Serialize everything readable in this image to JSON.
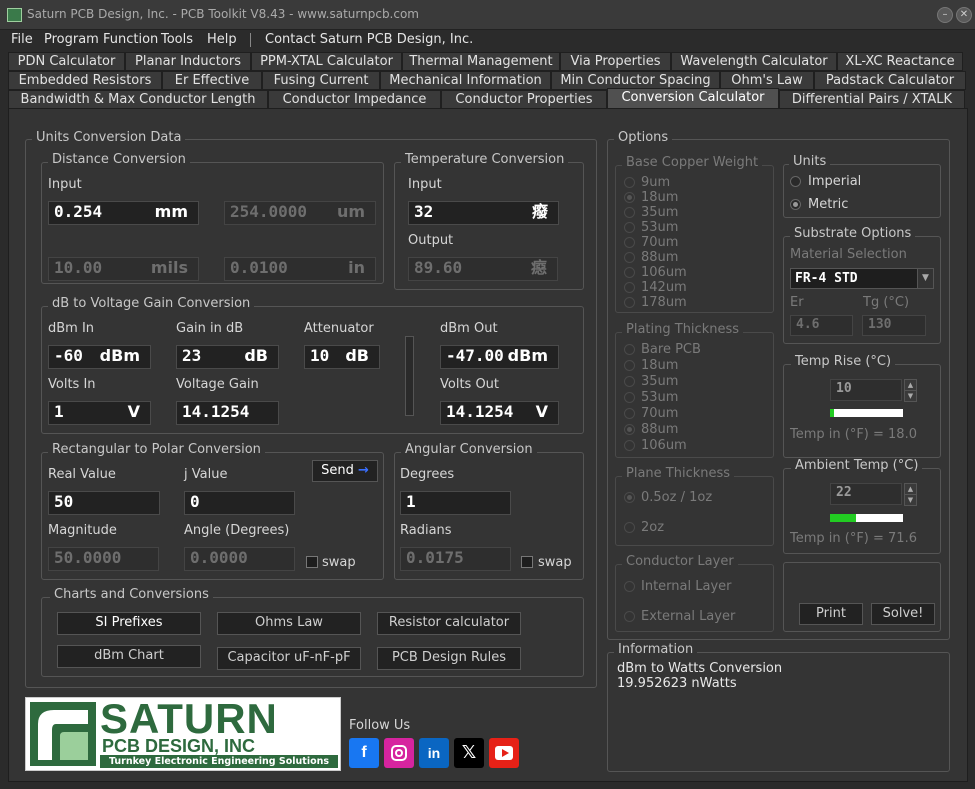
{
  "window": {
    "title": "Saturn PCB Design, Inc. - PCB Toolkit V8.43 - www.saturnpcb.com"
  },
  "menu": {
    "items": [
      "File",
      "Program Function",
      "Tools",
      "Help",
      "Contact Saturn PCB Design, Inc."
    ]
  },
  "tabs": {
    "row1": [
      "PDN Calculator",
      "Planar Inductors",
      "PPM-XTAL Calculator",
      "Thermal Management",
      "Via Properties",
      "Wavelength Calculator",
      "XL-XC Reactance"
    ],
    "row2": [
      "Embedded Resistors",
      "Er Effective",
      "Fusing Current",
      "Mechanical Information",
      "Min Conductor Spacing",
      "Ohm's Law",
      "Padstack Calculator"
    ],
    "row3": [
      "Bandwidth & Max Conductor Length",
      "Conductor Impedance",
      "Conductor Properties",
      "Conversion Calculator",
      "Differential Pairs / XTALK"
    ],
    "active": "Conversion Calculator"
  },
  "units_conversion": {
    "title": "Units Conversion Data"
  },
  "distance": {
    "title": "Distance Conversion",
    "input_label": "Input",
    "input_value": "0.254",
    "input_unit": "mm",
    "out1_value": "254.0000",
    "out1_unit": "um",
    "out2_value": "10.00",
    "out2_unit": "mils",
    "out3_value": "0.0100",
    "out3_unit": "in"
  },
  "temperature": {
    "title": "Temperature Conversion",
    "input_label": "Input",
    "input_value": "32",
    "input_unit": "癈",
    "output_label": "Output",
    "output_value": "89.60",
    "output_unit": "癋"
  },
  "db_gain": {
    "title": "dB to Voltage Gain Conversion",
    "dbm_in_label": "dBm In",
    "dbm_in_value": "-60",
    "dbm_in_unit": "dBm",
    "gain_db_label": "Gain in dB",
    "gain_db_value": "23",
    "gain_db_unit": "dB",
    "atten_label": "Attenuator",
    "atten_value": "10",
    "atten_unit": "dB",
    "dbm_out_label": "dBm Out",
    "dbm_out_value": "-47.00",
    "dbm_out_unit": "dBm",
    "volts_in_label": "Volts In",
    "volts_in_value": "1",
    "volts_in_unit": "V",
    "vgain_label": "Voltage Gain",
    "vgain_value": "14.1254",
    "volts_out_label": "Volts Out",
    "volts_out_value": "14.1254",
    "volts_out_unit": "V"
  },
  "rect_polar": {
    "title": "Rectangular to Polar Conversion",
    "real_label": "Real Value",
    "real_value": "50",
    "j_label": "j Value",
    "j_value": "0",
    "send_label": "Send",
    "mag_label": "Magnitude",
    "mag_value": "50.0000",
    "angle_label": "Angle (Degrees)",
    "angle_value": "0.0000",
    "swap_label": "swap"
  },
  "angular": {
    "title": "Angular Conversion",
    "deg_label": "Degrees",
    "deg_value": "1",
    "rad_label": "Radians",
    "rad_value": "0.0175",
    "swap_label": "swap"
  },
  "charts": {
    "title": "Charts and Conversions",
    "buttons": [
      "SI Prefixes",
      "Ohms Law",
      "Resistor calculator",
      "dBm Chart",
      "Capacitor uF-nF-pF",
      "PCB Design Rules"
    ]
  },
  "logo": {
    "line1": "SATURN",
    "line2": "PCB DESIGN, INC",
    "line3": "Turnkey Electronic Engineering Solutions"
  },
  "follow": {
    "label": "Follow Us",
    "icons": [
      "facebook-icon",
      "instagram-icon",
      "linkedin-icon",
      "x-icon",
      "youtube-icon"
    ]
  },
  "options": {
    "title": "Options",
    "base_copper": {
      "title": "Base Copper Weight",
      "items": [
        "9um",
        "18um",
        "35um",
        "53um",
        "70um",
        "88um",
        "106um",
        "142um",
        "178um"
      ],
      "selected": "18um"
    },
    "plating": {
      "title": "Plating Thickness",
      "items": [
        "Bare PCB",
        "18um",
        "35um",
        "53um",
        "70um",
        "88um",
        "106um"
      ],
      "selected": "88um"
    },
    "plane": {
      "title": "Plane Thickness",
      "items": [
        "0.5oz / 1oz",
        "2oz"
      ],
      "selected": "0.5oz / 1oz"
    },
    "conductor": {
      "title": "Conductor Layer",
      "items": [
        "Internal Layer",
        "External Layer"
      ]
    },
    "units": {
      "title": "Units",
      "items": [
        "Imperial",
        "Metric"
      ],
      "selected": "Metric"
    },
    "substrate": {
      "title": "Substrate Options",
      "material_label": "Material Selection",
      "material_value": "FR-4 STD",
      "er_label": "Er",
      "er_value": "4.6",
      "tg_label": "Tg (°C)",
      "tg_value": "130"
    },
    "temp_rise": {
      "title": "Temp Rise (°C)",
      "value": "10",
      "level": 0.02,
      "readout": "Temp in (°F) = 18.0"
    },
    "ambient": {
      "title": "Ambient Temp (°C)",
      "value": "22",
      "level": 0.35,
      "readout": "Temp in (°F) = 71.6"
    },
    "print_label": "Print",
    "solve_label": "Solve!"
  },
  "information": {
    "title": "Information",
    "line1": "dBm to Watts Conversion",
    "line2": "19.952623 nWatts"
  },
  "colors": {
    "accent_green": "#22cc22",
    "background": "#343434"
  }
}
